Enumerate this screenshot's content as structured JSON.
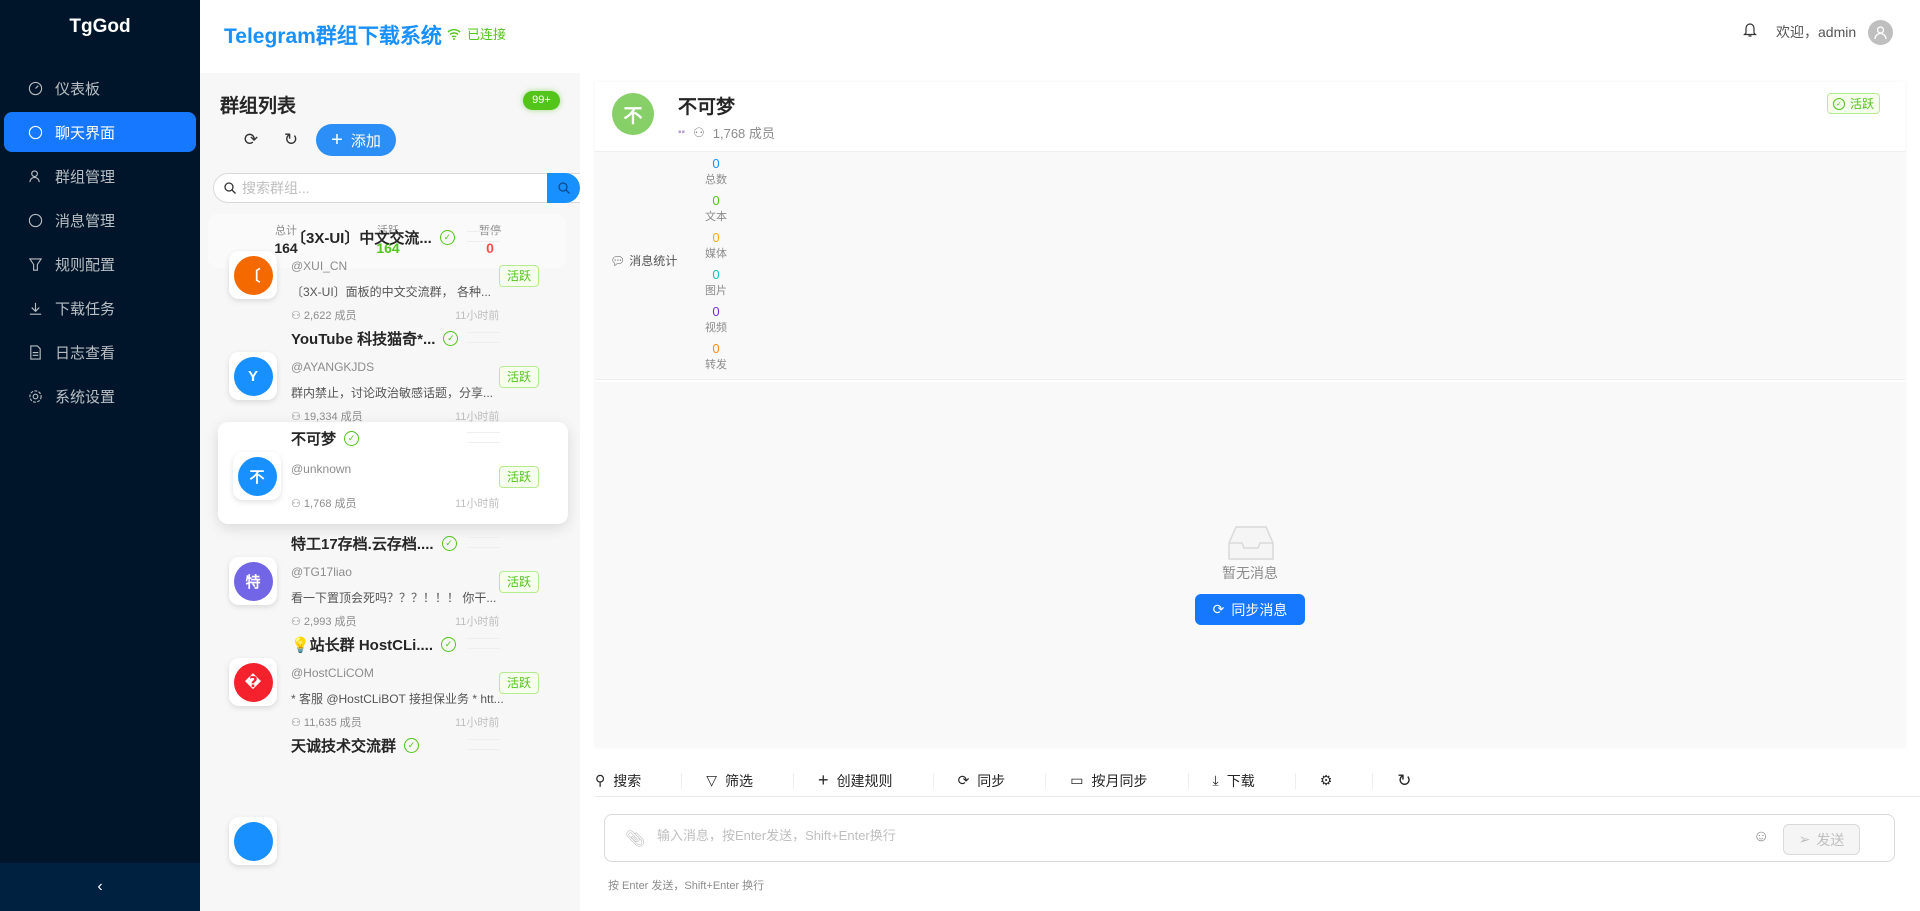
{
  "sidebar": {
    "logo": "TgGod",
    "items": [
      {
        "label": "仪表板",
        "icon": "dashboard-icon"
      },
      {
        "label": "聊天界面",
        "icon": "chat-icon",
        "active": true
      },
      {
        "label": "群组管理",
        "icon": "users-icon"
      },
      {
        "label": "消息管理",
        "icon": "message-icon"
      },
      {
        "label": "规则配置",
        "icon": "filter-icon"
      },
      {
        "label": "下载任务",
        "icon": "download-icon"
      },
      {
        "label": "日志查看",
        "icon": "file-icon"
      },
      {
        "label": "系统设置",
        "icon": "gear-icon"
      }
    ],
    "collapse": "‹"
  },
  "header": {
    "title": "Telegram群组下载系统",
    "status": "已连接",
    "welcome": "欢迎，admin"
  },
  "group_list": {
    "title": "群组列表",
    "badge": "99+",
    "add_label": "添加",
    "search_placeholder": "搜索群组...",
    "stats": {
      "total_label": "总计",
      "total": "164",
      "active_label": "活跃",
      "active": "164",
      "paused_label": "暂停",
      "paused": "0"
    },
    "groups": [
      {
        "title": "〔3X-UI〕中文交流...",
        "username": "@XUI_CN",
        "desc": "〔3X-UI〕面板的中文交流群， 各种...",
        "members": "2,622 成员",
        "time": "11小时前",
        "status": "活跃",
        "avatar": "〔",
        "color": "#f56a00"
      },
      {
        "title": "YouTube 科技猫奇*...",
        "username": "@AYANGKJDS",
        "desc": "群内禁止，讨论政治敏感话题，分享...",
        "members": "19,334 成员",
        "time": "11小时前",
        "status": "活跃",
        "avatar": "Y",
        "color": "#1890ff"
      },
      {
        "title": "不可梦",
        "username": "@unknown",
        "desc": "",
        "members": "1,768 成员",
        "time": "11小时前",
        "status": "活跃",
        "avatar": "不",
        "color": "#1890ff",
        "selected": true
      },
      {
        "title": "特工17存档.云存档....",
        "username": "@TG17liao",
        "desc": "看一下置顶会死吗？？？！！！ 你干...",
        "members": "2,993 成员",
        "time": "11小时前",
        "status": "活跃",
        "avatar": "特",
        "color": "#7265e6"
      },
      {
        "title": "💡站长群 HostCLi....",
        "username": "@HostCLiCOM",
        "desc": "* 客服 @HostCLiBOT 接担保业务 * htt...",
        "members": "11,635 成员",
        "time": "11小时前",
        "status": "活跃",
        "avatar": "�",
        "color": "#f5222d"
      },
      {
        "title": "天诚技术交流群",
        "username": "",
        "desc": "",
        "members": "",
        "time": "",
        "status": "",
        "avatar": "",
        "color": "#1890ff"
      }
    ]
  },
  "chat": {
    "avatar": "不",
    "name": "不可梦",
    "members": "1,768 成员",
    "status": "活跃",
    "stats_label": "消息统计",
    "stats": [
      {
        "value": "0",
        "label": "总数",
        "color": "#1890ff"
      },
      {
        "value": "0",
        "label": "文本",
        "color": "#52c41a"
      },
      {
        "value": "0",
        "label": "媒体",
        "color": "#faad14"
      },
      {
        "value": "0",
        "label": "图片",
        "color": "#13c2c2"
      },
      {
        "value": "0",
        "label": "视频",
        "color": "#722ed1"
      },
      {
        "value": "0",
        "label": "转发",
        "color": "#fa8c16"
      }
    ],
    "empty_text": "暂无消息",
    "sync_label": "同步消息"
  },
  "toolbar": {
    "search": "搜索",
    "filter": "筛选",
    "create_rule": "创建规则",
    "sync": "同步",
    "monthly_sync": "按月同步",
    "download": "下载"
  },
  "input": {
    "placeholder": "输入消息，按Enter发送，Shift+Enter换行",
    "value": "",
    "send": "发送",
    "hint": "按 Enter 发送，Shift+Enter 换行"
  }
}
